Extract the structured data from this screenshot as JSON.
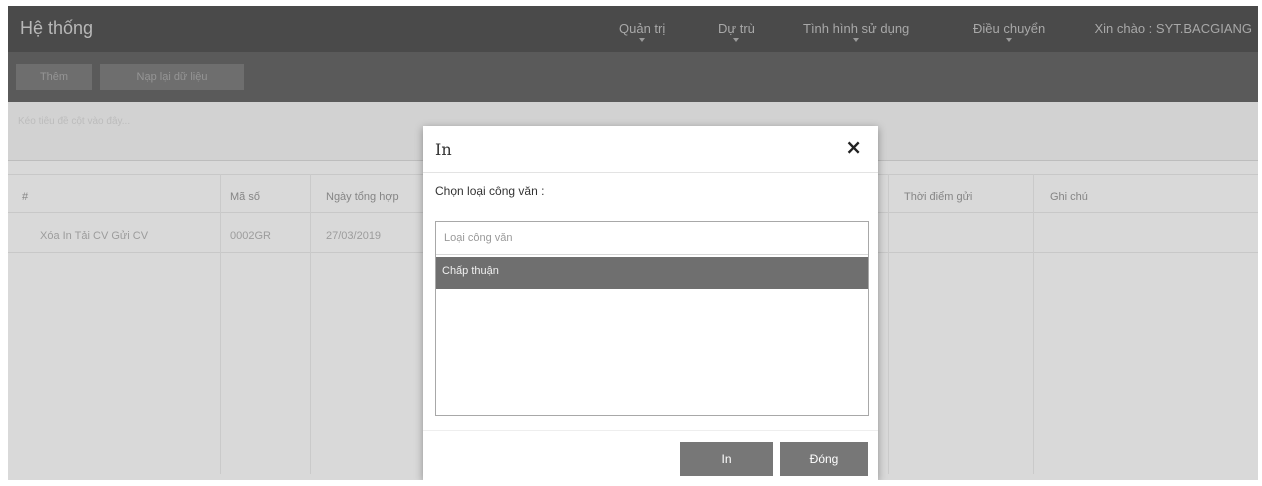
{
  "navbar": {
    "brand": "Hệ thống",
    "items": [
      {
        "label": "Quản trị"
      },
      {
        "label": "Dự trù"
      },
      {
        "label": "Tình hình sử dụng"
      },
      {
        "label": "Điều chuyển"
      }
    ],
    "greeting": "Xin chào : SYT.BACGIANG"
  },
  "toolbar": {
    "buttons": [
      {
        "label": "Thêm"
      },
      {
        "label": "Nạp lại dữ liệu"
      }
    ]
  },
  "filter": {
    "text": "Kéo tiêu đề cột vào đây..."
  },
  "table": {
    "columns": [
      "#",
      "Mã số",
      "Ngày tổng hợp",
      "Thời điểm gửi",
      "Ghi chú"
    ],
    "row": {
      "actions": "Xóa In Tải CV Gửi CV",
      "ma_so": "0002GR",
      "ngay_tong_hop": "27/03/2019"
    }
  },
  "modal": {
    "title": "In",
    "close": "×",
    "label": "Chọn loại công văn :",
    "search_placeholder": "Loại công văn",
    "options": [
      "Chấp thuận"
    ],
    "buttons": {
      "print": "In",
      "close": "Đóng"
    }
  },
  "colors": {
    "navbar": "#4a4a4a",
    "overlay": "#d9d9d9",
    "selected_option": "#6f6f6f",
    "button": "#777777"
  }
}
